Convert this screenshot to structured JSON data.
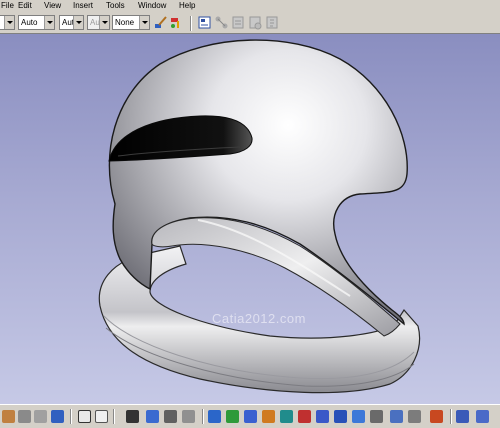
{
  "menu": {
    "items": [
      {
        "label": "File",
        "mnemonic": "F"
      },
      {
        "label": "Edit",
        "mnemonic": "E"
      },
      {
        "label": "View",
        "mnemonic": "V"
      },
      {
        "label": "Insert",
        "mnemonic": "I"
      },
      {
        "label": "Tools",
        "mnemonic": "T"
      },
      {
        "label": "Window",
        "mnemonic": "W"
      },
      {
        "label": "Help",
        "mnemonic": "H"
      }
    ]
  },
  "toolbar": {
    "style_select": "",
    "weight_select": "Auto",
    "thickness_select": "Aut",
    "linetype_select": "Aut",
    "layer_select": "None",
    "icons": [
      "brush-icon",
      "painter-icon",
      "properties-icon",
      "graph-icon",
      "knowledge-icon",
      "rules-icon",
      "formula-icon"
    ]
  },
  "viewport": {
    "watermark": "Catia2012.com",
    "background_top": "#8a8ec0",
    "background_bottom": "#c6c9e6"
  },
  "bottom_toolbar": {
    "icons": [
      "paste-icon",
      "undo-icon",
      "redo-icon",
      "whats-this-icon",
      "formula-fx-icon",
      "comment-icon",
      "table-icon",
      "catalog-icon",
      "scan-icon",
      "fly-mode-icon",
      "fit-all-icon",
      "pan-icon",
      "rotate-icon",
      "zoom-in-icon",
      "zoom-out-icon",
      "normal-view-icon",
      "multiview-icon",
      "iso-view-icon",
      "shading-icon",
      "hide-show-icon",
      "swap-icon",
      "measure-icon",
      "apply-material-icon"
    ]
  }
}
